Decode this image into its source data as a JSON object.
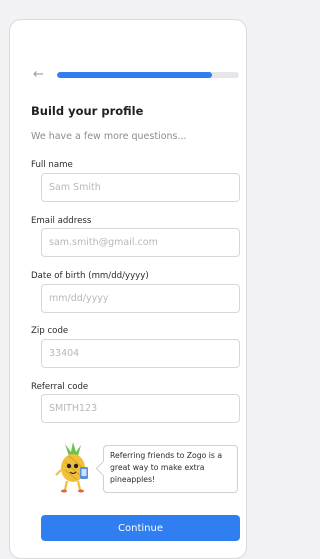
{
  "header": {
    "back_icon": "arrow-left-icon",
    "progress_fraction": 0.85
  },
  "main": {
    "title": "Build your profile",
    "subtitle": "We have a few more questions...",
    "fields": [
      {
        "label": "Full name",
        "placeholder": "Sam Smith"
      },
      {
        "label": "Email address",
        "placeholder": "sam.smith@gmail.com"
      },
      {
        "label": "Date of birth (mm/dd/yyyy)",
        "placeholder": "mm/dd/yyyy"
      },
      {
        "label": "Zip code",
        "placeholder": "33404"
      },
      {
        "label": "Referral code",
        "placeholder": "SMITH123"
      }
    ],
    "referral_message": "Referring friends to Zogo is a great way to make extra pineapples!",
    "mascot_icon": "pineapple-mascot-icon",
    "continue_label": "Continue"
  },
  "colors": {
    "accent": "#2f7ff0",
    "progress_track": "#e6e6ea",
    "mascot_body": "#f0c03a",
    "mascot_leaves": "#69c24a"
  }
}
